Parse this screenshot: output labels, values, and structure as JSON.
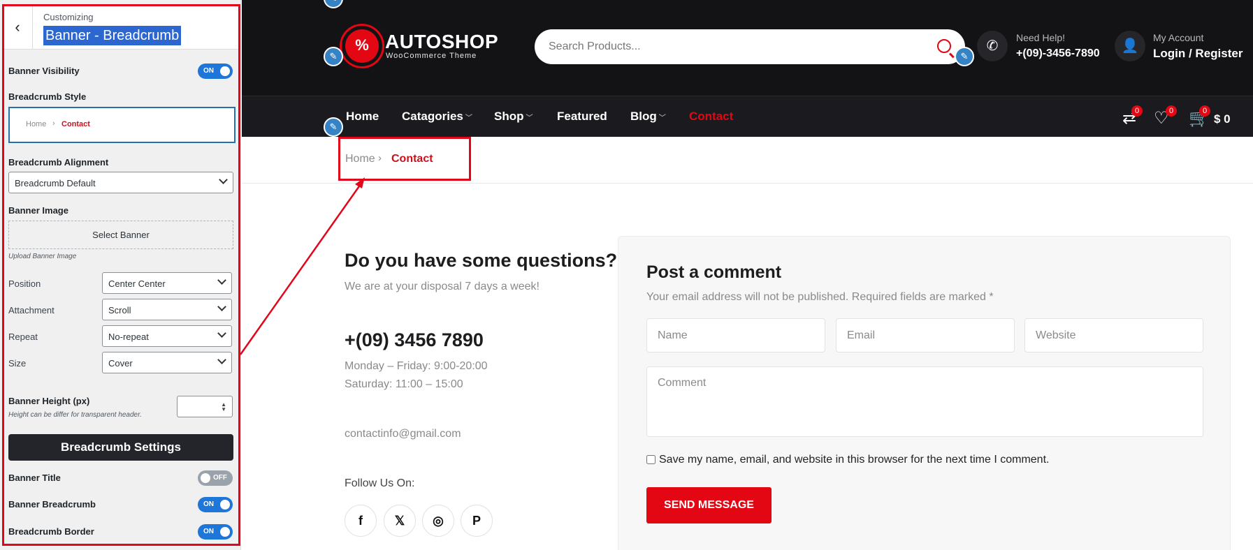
{
  "customizer": {
    "subtitle": "Customizing",
    "title": "Banner - Breadcrumb",
    "banner_visibility": {
      "label": "Banner Visibility",
      "state": "ON"
    },
    "breadcrumb_style": {
      "label": "Breadcrumb Style",
      "home": "Home",
      "sep": "›",
      "current": "Contact"
    },
    "breadcrumb_alignment": {
      "label": "Breadcrumb Alignment",
      "value": "Breadcrumb Default"
    },
    "banner_image": {
      "label": "Banner Image",
      "button": "Select Banner",
      "hint": "Upload Banner Image"
    },
    "position": {
      "label": "Position",
      "value": "Center Center"
    },
    "attachment": {
      "label": "Attachment",
      "value": "Scroll"
    },
    "repeat": {
      "label": "Repeat",
      "value": "No-repeat"
    },
    "size": {
      "label": "Size",
      "value": "Cover"
    },
    "banner_height": {
      "label": "Banner Height (px)",
      "hint": "Height can be differ for transparent header.",
      "value": ""
    },
    "breadcrumb_settings": "Breadcrumb Settings",
    "banner_title": {
      "label": "Banner Title",
      "state": "OFF"
    },
    "banner_breadcrumb": {
      "label": "Banner Breadcrumb",
      "state": "ON"
    },
    "breadcrumb_border": {
      "label": "Breadcrumb Border",
      "state": "ON"
    }
  },
  "site": {
    "logo": {
      "title": "AUTOSHOP",
      "subtitle": "WooCommerce Theme",
      "mark": "%"
    },
    "search": {
      "placeholder": "Search Products..."
    },
    "help": {
      "label": "Need Help!",
      "phone": "+(09)-3456-7890"
    },
    "account": {
      "label": "My Account",
      "link": "Login / Register"
    },
    "nav": {
      "home": "Home",
      "categories": "Catagories",
      "shop": "Shop",
      "featured": "Featured",
      "blog": "Blog",
      "contact": "Contact",
      "compare_count": "0",
      "wishlist_count": "0",
      "cart_count": "0",
      "cart_total": "$ 0"
    },
    "breadcrumb": {
      "home": "Home",
      "sep": "›",
      "current": "Contact"
    },
    "contact": {
      "title": "Do you have some questions?",
      "subtitle": "We are at your disposal 7 days a week!",
      "phone": "+(09) 3456 7890",
      "hours_weekdays": "Monday – Friday: 9:00-20:00",
      "hours_saturday": "Saturday: 11:00 – 15:00",
      "email": "contactinfo@gmail.com",
      "follow": "Follow Us On:"
    },
    "comment": {
      "title": "Post a comment",
      "note": "Your email address will not be published. Required fields are marked *",
      "name_placeholder": "Name",
      "email_placeholder": "Email",
      "website_placeholder": "Website",
      "comment_placeholder": "Comment",
      "save_label": "Save my name, email, and website in this browser for the next time I comment.",
      "send": "SEND MESSAGE"
    }
  },
  "colors": {
    "accent": "#e30613",
    "toggle_on": "#1e76d9",
    "annotation": "#e3061a"
  },
  "icons": [
    "back-icon",
    "search-icon",
    "phone-icon",
    "user-icon",
    "compare-icon",
    "heart-icon",
    "cart-icon",
    "edit-icon",
    "facebook-icon",
    "twitter-icon",
    "instagram-icon",
    "pinterest-icon"
  ]
}
